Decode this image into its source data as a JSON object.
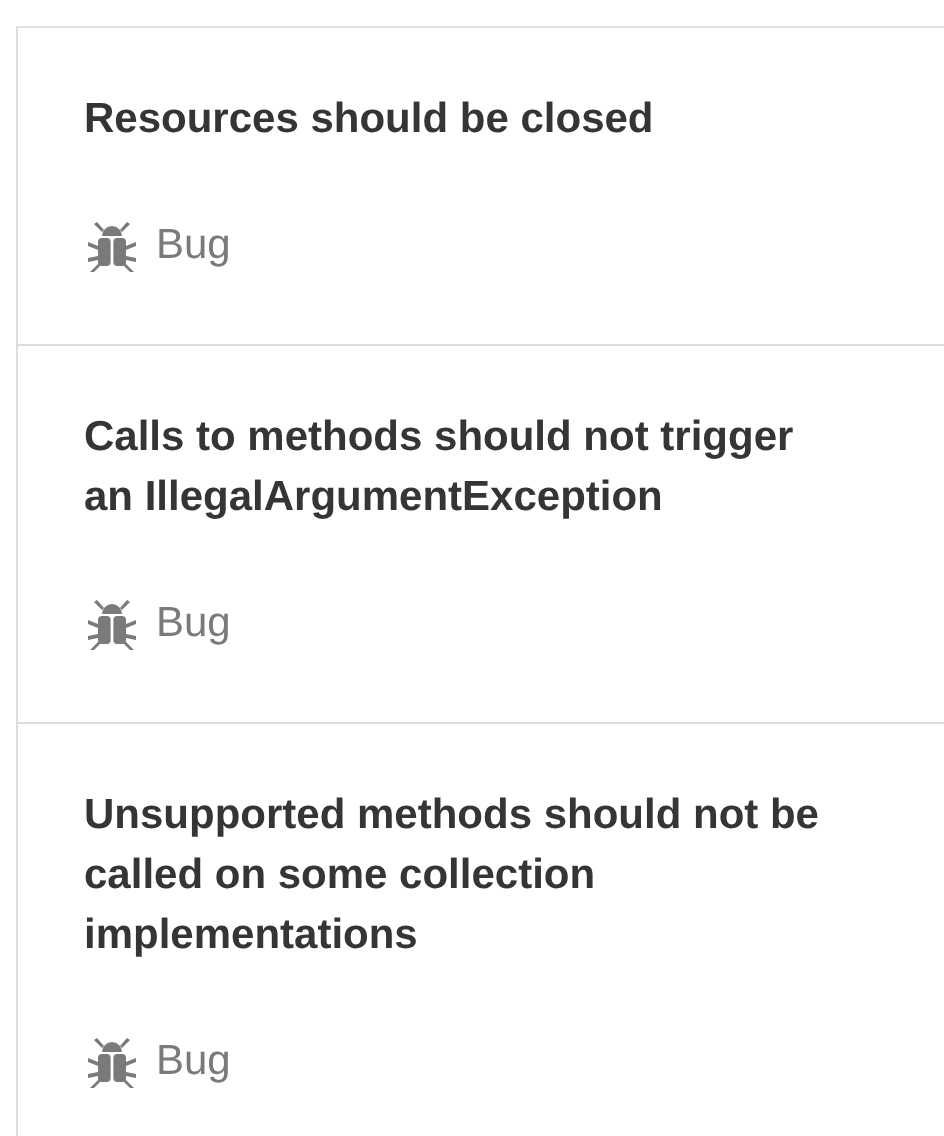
{
  "rules": [
    {
      "title": "Resources should be closed",
      "type": {
        "kind": "bug",
        "label": "Bug"
      }
    },
    {
      "title": "Calls to methods should not trigger an IllegalArgumentException",
      "type": {
        "kind": "bug",
        "label": "Bug"
      }
    },
    {
      "title": "Unsupported methods should not be called on some collection implementations",
      "type": {
        "kind": "bug",
        "label": "Bug"
      }
    }
  ]
}
